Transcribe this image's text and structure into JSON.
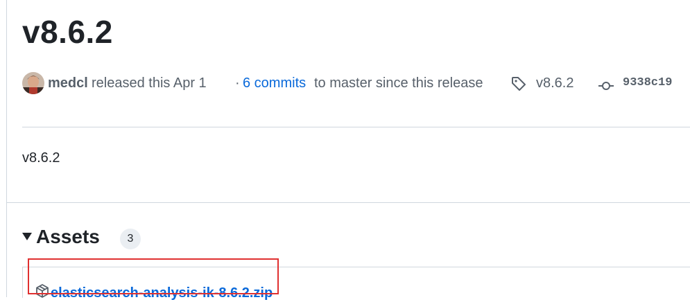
{
  "release": {
    "title": "v8.6.2",
    "author": "medcl",
    "released_text": "released this Apr 1",
    "separator": "·",
    "commits_link": "6 commits",
    "commits_suffix": "to master since this release",
    "tag": "v8.6.2",
    "commit_sha": "9338c19",
    "body": "v8.6.2"
  },
  "assets": {
    "title": "Assets",
    "count": "3",
    "items": [
      {
        "name": "elasticsearch-analysis-ik-8.6.2.zip",
        "icon": "package-icon"
      }
    ]
  },
  "colors": {
    "link": "#0969da",
    "muted": "#57606a",
    "border": "#d0d7de",
    "highlight": "#e03030"
  }
}
